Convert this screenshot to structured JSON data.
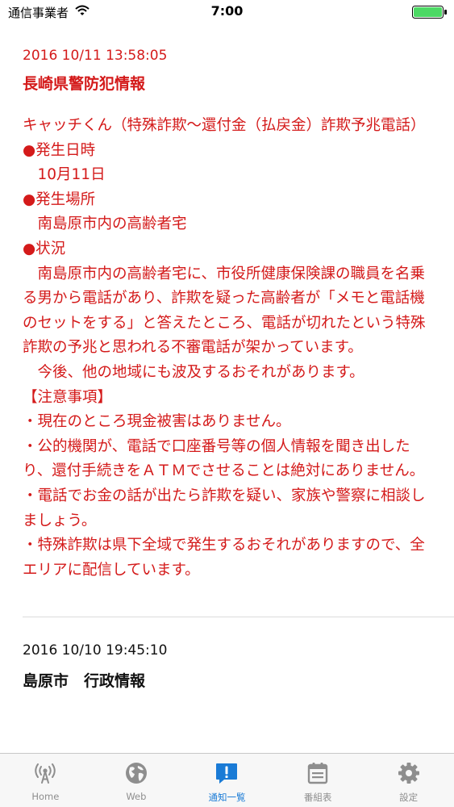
{
  "status_bar": {
    "carrier": "通信事業者",
    "time": "7:00"
  },
  "notices": [
    {
      "timestamp": "2016 10/11 13:58:05",
      "title": "長崎県警防犯情報",
      "body": "キャッチくん（特殊詐欺〜還付金（払戻金）詐欺予兆電話）●発生日時\n　10月11日\n●発生場所\n　南島原市内の高齢者宅\n●状況\n　南島原市内の高齢者宅に、市役所健康保険課の職員を名乗る男から電話があり、詐欺を疑った高齢者が「メモと電話機のセットをする」と答えたところ、電話が切れたという特殊詐欺の予兆と思われる不審電話が架かっています。\n　今後、他の地域にも波及するおそれがあります。\n【注意事項】\n・現在のところ現金被害はありません。\n・公的機関が、電話で口座番号等の個人情報を聞き出したり、還付手続きをＡＴＭでさせることは絶対にありません。\n・電話でお金の話が出たら詐欺を疑い、家族や警察に相談しましょう。\n・特殊詐欺は県下全域で発生するおそれがありますので、全エリアに配信しています。"
    },
    {
      "timestamp": "2016 10/10 19:45:10",
      "title": "島原市　行政情報"
    }
  ],
  "tabs": [
    {
      "label": "Home",
      "icon": "broadcast-icon"
    },
    {
      "label": "Web",
      "icon": "globe-icon"
    },
    {
      "label": "通知一覧",
      "icon": "alert-bubble-icon"
    },
    {
      "label": "番組表",
      "icon": "calendar-icon"
    },
    {
      "label": "設定",
      "icon": "gear-icon"
    }
  ],
  "colors": {
    "alert_red": "#d41a1a",
    "active_blue": "#1a7bd6",
    "inactive_gray": "#8e8e8e",
    "battery_green": "#4cd964"
  }
}
